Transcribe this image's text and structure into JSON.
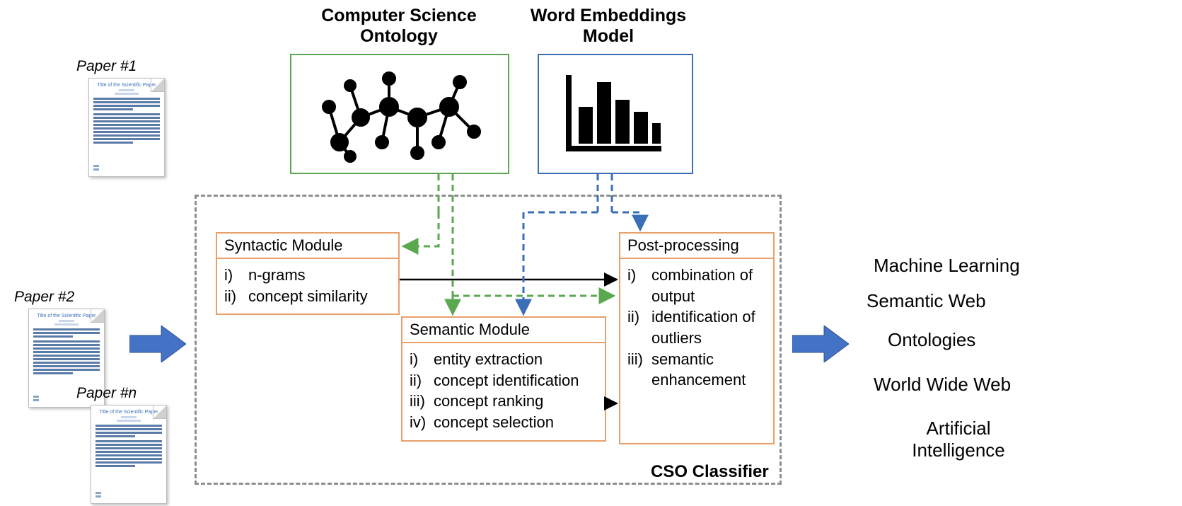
{
  "topLabels": {
    "cso": "Computer Science\nOntology",
    "we": "Word Embeddings\nModel"
  },
  "classifierLabel": "CSO Classifier",
  "modules": {
    "syntactic": {
      "title": "Syntactic Module",
      "steps": [
        {
          "num": "i)",
          "text": "n-grams"
        },
        {
          "num": "ii)",
          "text": "concept similarity"
        }
      ]
    },
    "semantic": {
      "title": "Semantic Module",
      "steps": [
        {
          "num": "i)",
          "text": "entity extraction"
        },
        {
          "num": "ii)",
          "text": "concept identification"
        },
        {
          "num": "iii)",
          "text": "concept ranking"
        },
        {
          "num": "iv)",
          "text": "concept selection"
        }
      ]
    },
    "post": {
      "title": "Post-processing",
      "steps": [
        {
          "num": "i)",
          "text": "combination of output"
        },
        {
          "num": "ii)",
          "text": "identification of outliers"
        },
        {
          "num": "iii)",
          "text": "semantic enhancement"
        }
      ]
    }
  },
  "papers": {
    "labels": [
      "Paper #1",
      "Paper #2",
      "Paper #n"
    ],
    "mockTitle": "Title of the Scientific Paper"
  },
  "outputs": [
    "Machine Learning",
    "Semantic Web",
    "Ontologies",
    "World Wide Web",
    "Artificial Intelligence"
  ],
  "colors": {
    "green": "#5aa84f",
    "blue": "#3a6fb7",
    "orange": "#e8a06a",
    "arrowFill": "#4472c4"
  }
}
